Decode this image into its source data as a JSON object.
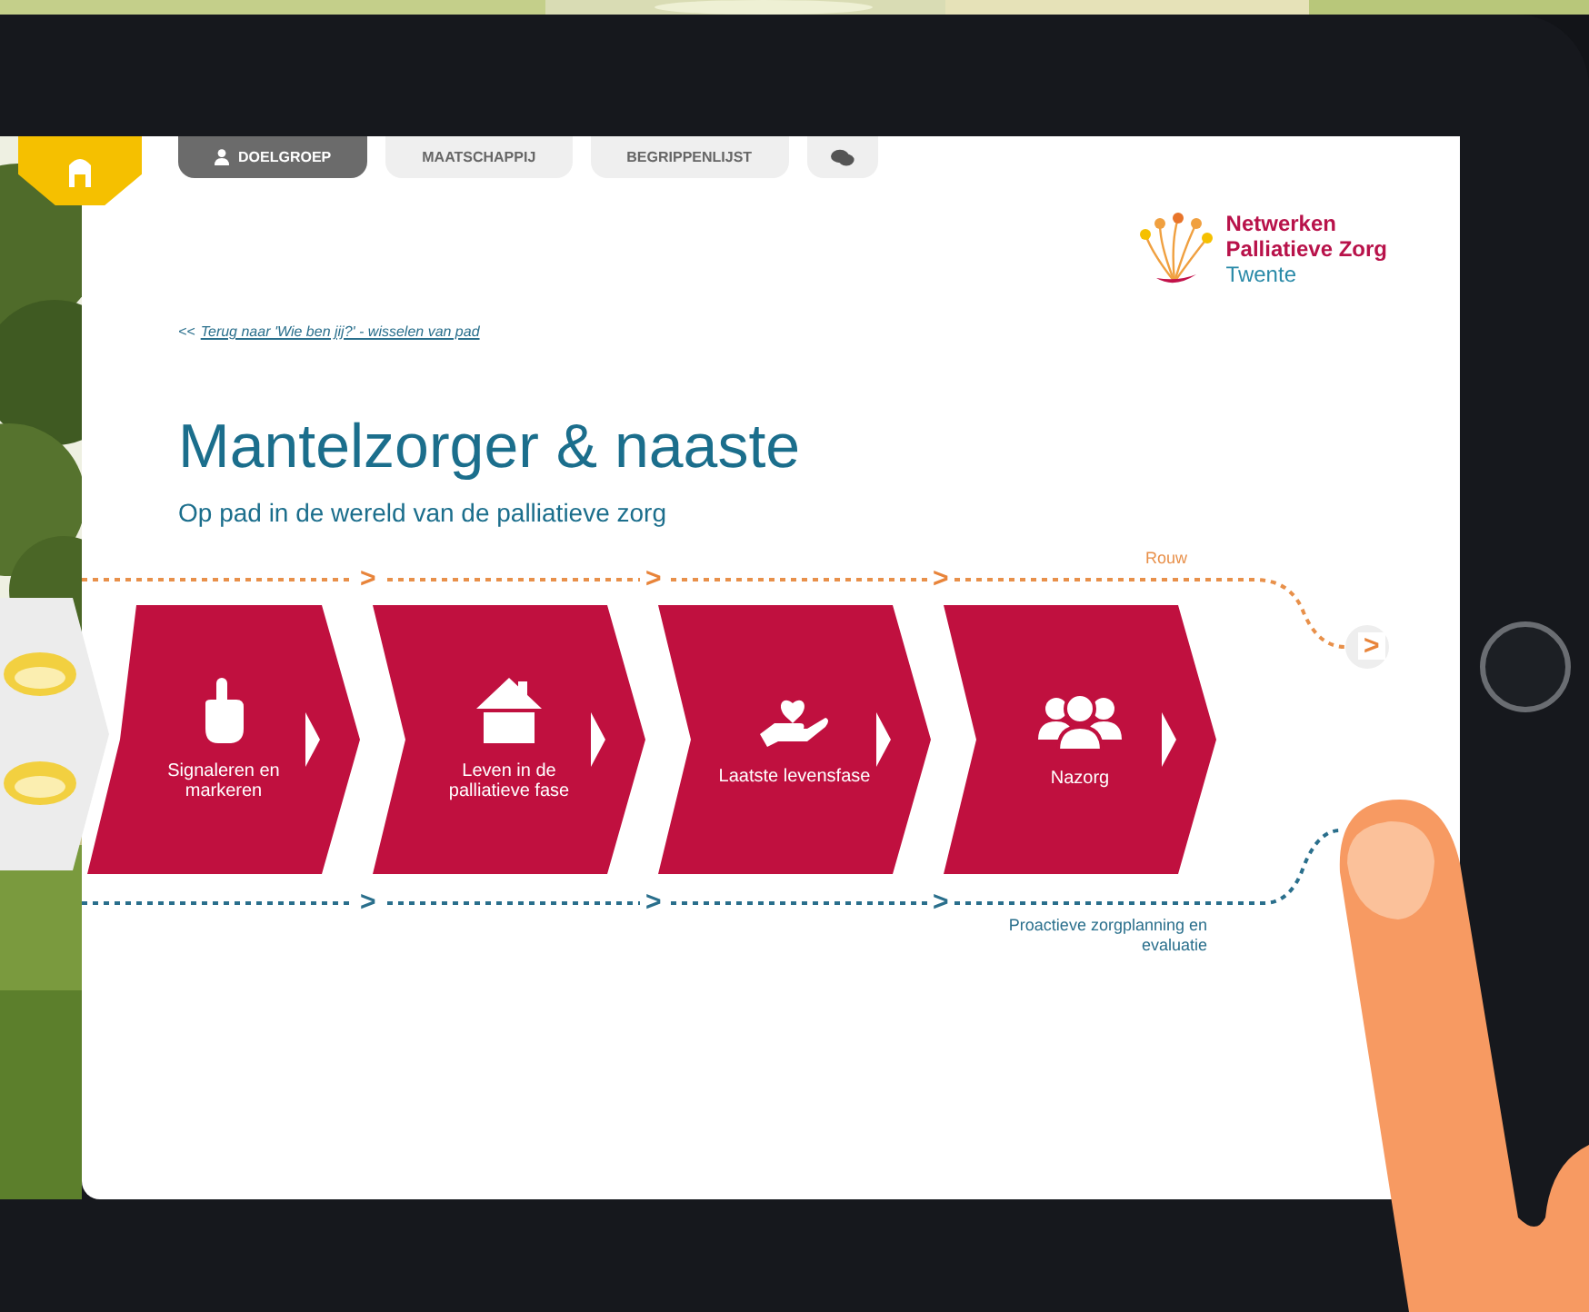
{
  "tabs": [
    {
      "kind": "home",
      "selected": false
    },
    {
      "kind": "text",
      "label": "DOELGROEP",
      "selected": true
    },
    {
      "kind": "text",
      "label": "MAATSCHAPPIJ",
      "selected": false
    },
    {
      "kind": "text",
      "label": "BEGRIPPENLIJST",
      "selected": false
    },
    {
      "kind": "chat",
      "selected": false
    }
  ],
  "logo": {
    "lines": [
      "Netwerken",
      "Palliatieve Zorg",
      "Twente"
    ]
  },
  "back_link": {
    "prefix": "<<",
    "text": "Terug naar 'Wie ben jij?' - wisselen van pad"
  },
  "title": "Mantelzorger & naaste",
  "subtitle": "Op pad in de wereld van de palliatieve zorg",
  "top_track": {
    "label": "Rouw",
    "markers": [
      ">",
      ">",
      ">"
    ],
    "end_marker": ">"
  },
  "stages": [
    {
      "kind": "pointing-hand",
      "label": "Signaleren en markeren"
    },
    {
      "kind": "house",
      "label": "Leven in de palliatieve fase"
    },
    {
      "kind": "hand-heart",
      "label": "Laatste levensfase"
    },
    {
      "kind": "group",
      "label": "Nazorg"
    }
  ],
  "bottom_track": {
    "label": "Proactieve zorgplanning en evaluatie",
    "markers": [
      ">",
      ">",
      ">"
    ]
  }
}
